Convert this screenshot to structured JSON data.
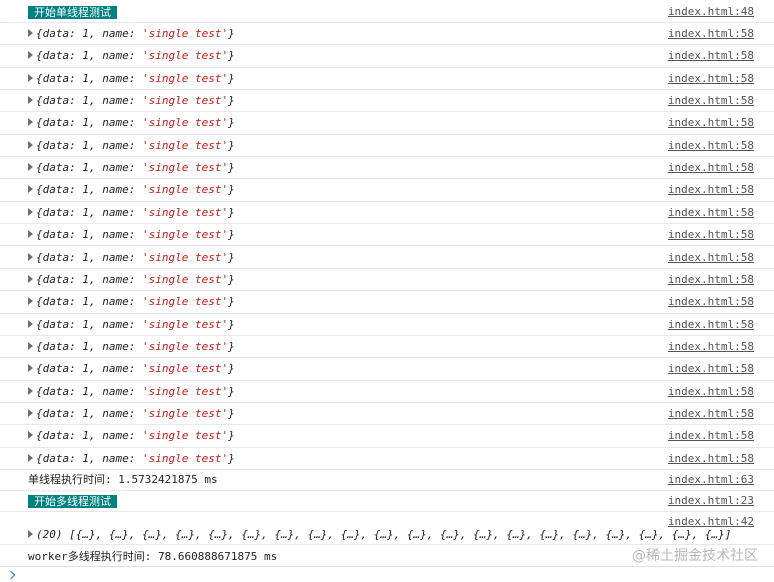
{
  "console": {
    "single_start": {
      "label": "开始单线程测试",
      "source": "index.html:48"
    },
    "object_entry": {
      "prefix": "{data: 1, name: ",
      "value": "'single test'",
      "suffix": "}",
      "source": "index.html:58"
    },
    "object_count": 20,
    "single_time": {
      "text": "单线程执行时间: 1.5732421875 ms",
      "source": "index.html:63"
    },
    "multi_start": {
      "label": "开始多线程测试",
      "source": "index.html:23"
    },
    "array_entry": {
      "text": "(20) [{…}, {…}, {…}, {…}, {…}, {…}, {…}, {…}, {…}, {…}, {…}, {…}, {…}, {…}, {…}, {…}, {…}, {…}, {…}, {…}]",
      "source": "index.html:42"
    },
    "worker_time": {
      "text": "worker多线程执行时间: 78.660888671875 ms"
    }
  },
  "watermark": "@稀土掘金技术社区",
  "colors": {
    "badge_bg": "#008080",
    "string": "#c41a16",
    "prompt": "#1a73e8"
  },
  "icons": [
    "expand-triangle-icon",
    "prompt-chevron-icon"
  ]
}
